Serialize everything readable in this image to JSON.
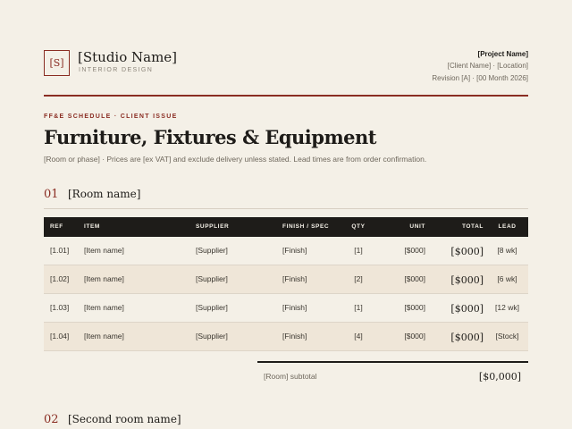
{
  "studio": {
    "logo_initial": "[S]",
    "name": "[Studio Name]",
    "subtitle": "INTERIOR DESIGN"
  },
  "project": {
    "name": "[Project Name]",
    "client_location": "[Client Name] · [Location]",
    "revision": "Revision [A] · [00 Month 2026]"
  },
  "doc": {
    "eyebrow": "FF&E SCHEDULE · CLIENT ISSUE",
    "title": "Furniture, Fixtures & Equipment",
    "intro": "[Room or phase] · Prices are [ex VAT] and exclude delivery unless stated. Lead times are from order confirmation."
  },
  "colors": {
    "accent": "#8a2d23",
    "ink": "#1e1c19",
    "paper": "#f4f0e7",
    "row_alt": "#efe6d8"
  },
  "table_headers": {
    "ref": "REF",
    "item": "ITEM",
    "supplier": "SUPPLIER",
    "finish": "FINISH / SPEC",
    "qty": "QTY",
    "unit": "UNIT",
    "total": "TOTAL",
    "lead": "LEAD"
  },
  "sections": [
    {
      "number": "01",
      "name": "[Room name]",
      "rows": [
        {
          "ref": "[1.01]",
          "item": "[Item name]",
          "supplier": "[Supplier]",
          "finish": "[Finish]",
          "qty": "[1]",
          "unit": "[$000]",
          "total": "[$000]",
          "lead": "[8 wk]"
        },
        {
          "ref": "[1.02]",
          "item": "[Item name]",
          "supplier": "[Supplier]",
          "finish": "[Finish]",
          "qty": "[2]",
          "unit": "[$000]",
          "total": "[$000]",
          "lead": "[6 wk]"
        },
        {
          "ref": "[1.03]",
          "item": "[Item name]",
          "supplier": "[Supplier]",
          "finish": "[Finish]",
          "qty": "[1]",
          "unit": "[$000]",
          "total": "[$000]",
          "lead": "[12 wk]"
        },
        {
          "ref": "[1.04]",
          "item": "[Item name]",
          "supplier": "[Supplier]",
          "finish": "[Finish]",
          "qty": "[4]",
          "unit": "[$000]",
          "total": "[$000]",
          "lead": "[Stock]"
        }
      ],
      "subtotal_label": "[Room] subtotal",
      "subtotal_value": "[$0,000]"
    },
    {
      "number": "02",
      "name": "[Second room name]"
    }
  ]
}
